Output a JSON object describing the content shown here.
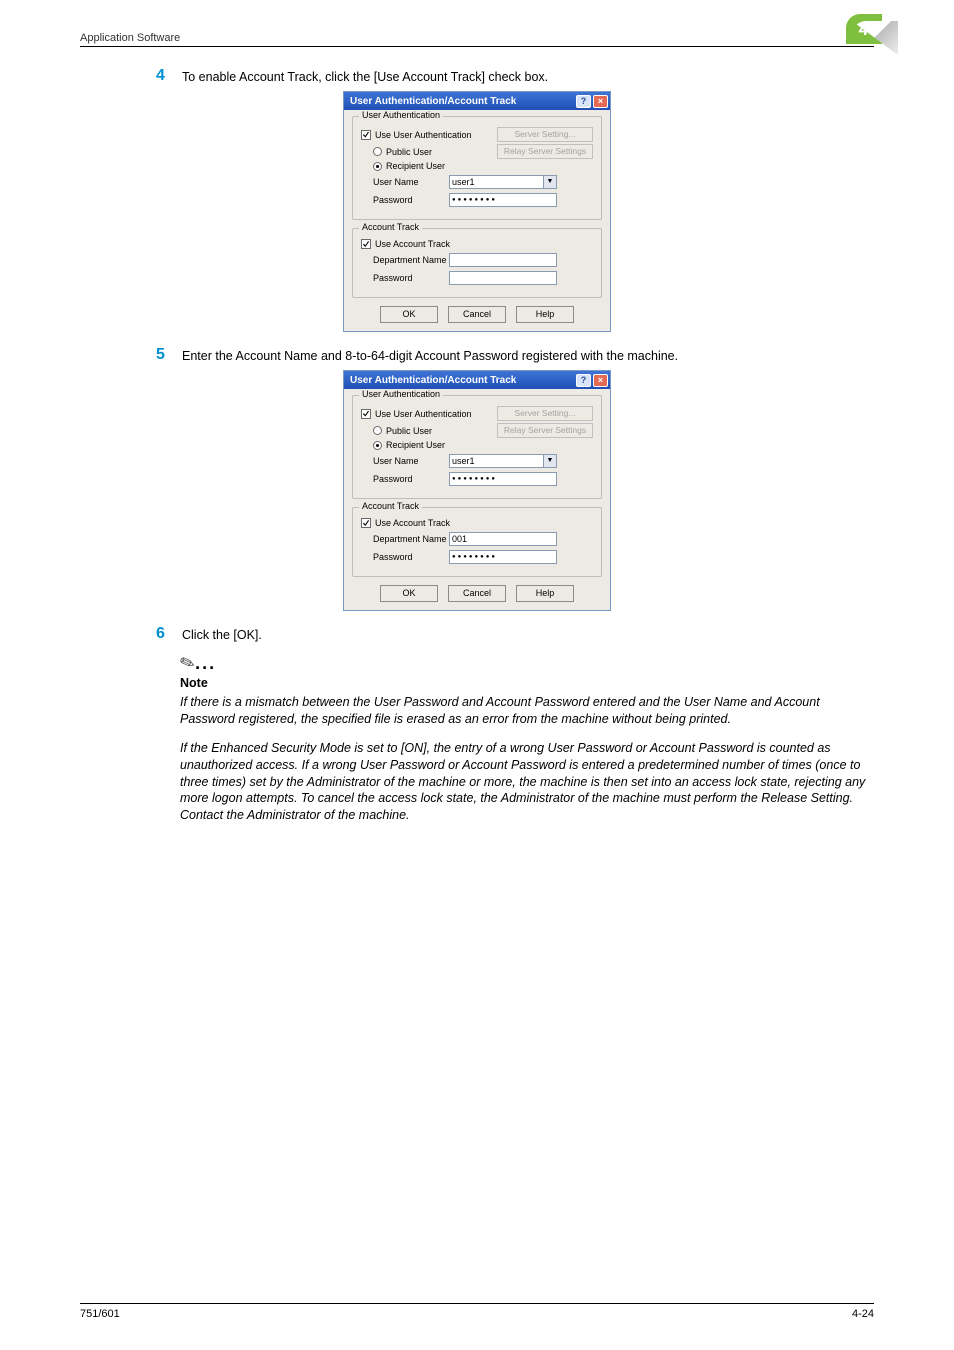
{
  "header": {
    "title": "Application Software",
    "section_number": "4"
  },
  "steps": {
    "s4": {
      "num": "4",
      "text": "To enable Account Track, click the [Use Account Track] check box."
    },
    "s5": {
      "num": "5",
      "text": "Enter the Account Name and 8-to-64-digit Account Password registered with the machine."
    },
    "s6": {
      "num": "6",
      "text": "Click the [OK]."
    }
  },
  "dialog": {
    "title": "User Authentication/Account Track",
    "ua_group": "User Authentication",
    "use_ua": "Use User Authentication",
    "public_user": "Public User",
    "recipient_user": "Recipient User",
    "user_name_label": "User Name",
    "user_name_value": "user1",
    "password_label": "Password",
    "password_mask": "●●●●●●●●",
    "server_setting": "Server Setting...",
    "relay_server": "Relay Server Settings",
    "at_group": "Account Track",
    "use_at": "Use Account Track",
    "dept_label": "Department Name",
    "dept_value_2": "001",
    "at_pwd_label": "Password",
    "at_pwd_mask_2": "●●●●●●●●",
    "ok": "OK",
    "cancel": "Cancel",
    "help": "Help",
    "helpbtn": "?",
    "closebtn": "×"
  },
  "note": {
    "heading": "Note",
    "p1": "If there is a mismatch between the User Password and Account Password entered and the User Name and Account Password registered, the specified file is erased as an error from the machine without being printed.",
    "p2": "If the Enhanced Security Mode is set to [ON], the entry of a wrong User Password or Account Password is counted as unauthorized access. If a wrong User Password or Account Password is entered a predetermined number of times (once to three times) set by the Administrator of the machine or more, the machine is then set into an access lock state, rejecting any more logon attempts. To cancel the access lock state, the Administrator of the machine must perform the Release Setting. Contact the Administrator of the machine."
  },
  "footer": {
    "left": "751/601",
    "right": "4-24"
  }
}
